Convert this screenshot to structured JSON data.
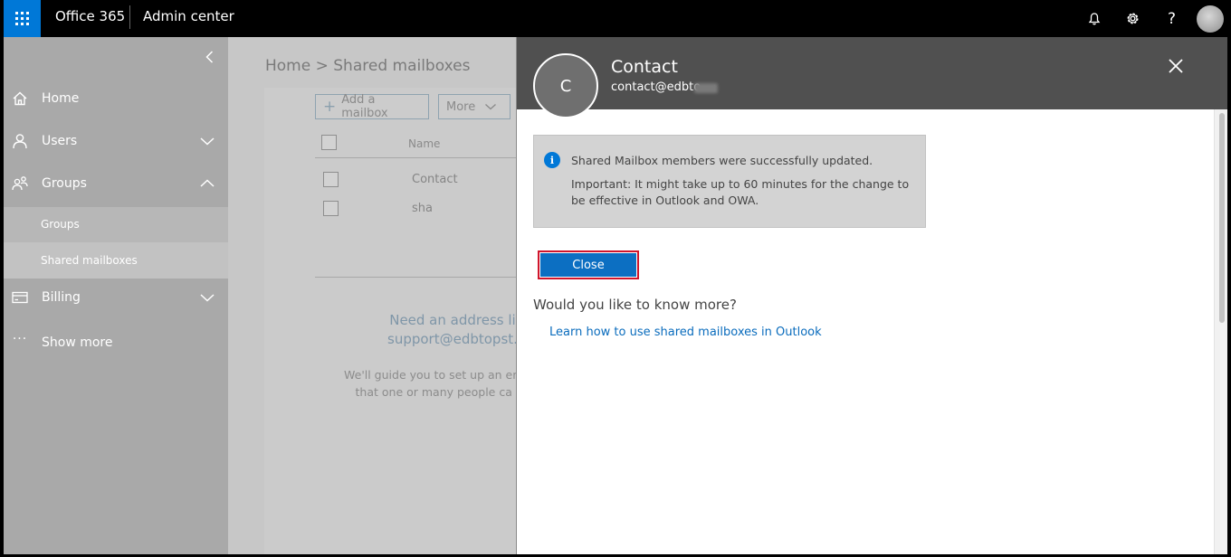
{
  "topbar": {
    "brand": "Office 365",
    "app_name": "Admin center"
  },
  "sidebar": {
    "items": [
      {
        "label": "Home",
        "icon": "home-icon"
      },
      {
        "label": "Users",
        "icon": "user-icon"
      },
      {
        "label": "Groups",
        "icon": "groups-icon"
      },
      {
        "label": "Groups"
      },
      {
        "label": "Shared mailboxes"
      },
      {
        "label": "Billing",
        "icon": "credit-card-icon"
      },
      {
        "label": "Show more",
        "icon": "ellipsis-icon"
      }
    ]
  },
  "main": {
    "breadcrumb": "Home > Shared mailboxes",
    "toolbar": {
      "add_label": "Add a mailbox",
      "more_label": "More"
    },
    "table": {
      "column_name": "Name",
      "rows": [
        "Contact",
        "sha"
      ]
    },
    "empty_state": {
      "title_line1": "Need an address li",
      "title_line2": "support@edbtopst.",
      "desc_line1": "We'll guide you to set up an em",
      "desc_line2": "that one or many people ca"
    }
  },
  "panel": {
    "avatar_initial": "C",
    "title": "Contact",
    "email": "contact@edbto",
    "info_message": "Shared Mailbox members were successfully updated.",
    "info_note": "Important: It might take up to 60 minutes for the change to be effective in Outlook and OWA.",
    "close_label": "Close",
    "more_question": "Would you like to know more?",
    "learn_link": "Learn how to use shared mailboxes in Outlook"
  },
  "colors": {
    "accent": "#0078d7",
    "highlight_border": "#d0152b",
    "panel_header": "#505050"
  }
}
